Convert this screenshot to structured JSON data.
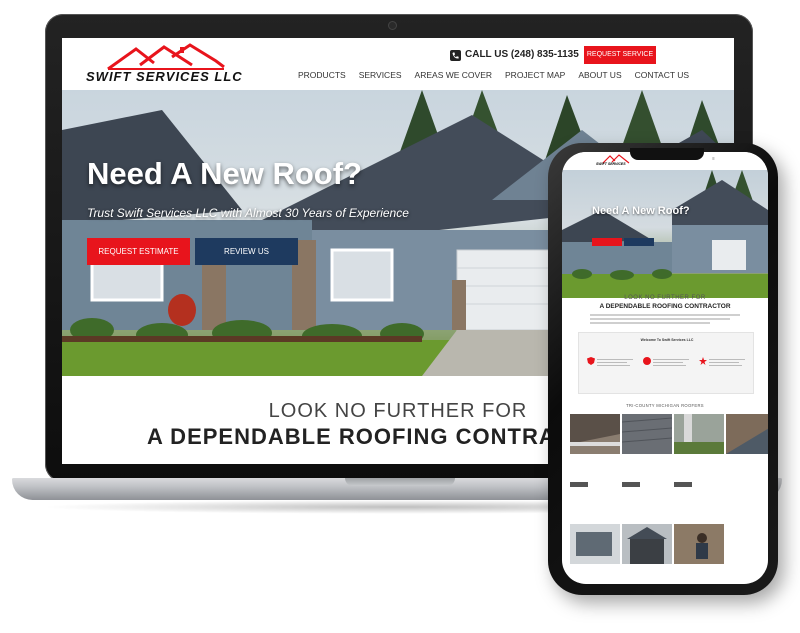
{
  "laptop_site": {
    "brand": "SWIFT SERVICES LLC",
    "phone": "CALL US (248) 835-1135",
    "request_service": "REQUEST SERVICE",
    "nav": [
      "PRODUCTS",
      "SERVICES",
      "AREAS WE COVER",
      "PROJECT MAP",
      "ABOUT US",
      "CONTACT US"
    ],
    "hero_title": "Need A New Roof?",
    "hero_subtitle": "Trust Swift Services LLC with Almost 30 Years of Experience",
    "request_estimate": "REQUEST ESTIMATE",
    "review_us": "REVIEW US",
    "section_light": "LOOK NO FURTHER FOR",
    "section_bold": "A DEPENDABLE ROOFING CONTRACT"
  },
  "mobile_site": {
    "brand": "SWIFT SERVICES",
    "hero_title": "Need A New Roof?",
    "look_light": "LOOK NO FURTHER FOR",
    "look_bold": "A DEPENDABLE ROOFING CONTRACTOR",
    "welcome": "Welcome To Swift Services LLC",
    "tri_county": "TRI-COUNTY MICHIGAN ROOFERS"
  },
  "colors": {
    "accent_red": "#e8141c",
    "navy": "#1e3a5f"
  }
}
